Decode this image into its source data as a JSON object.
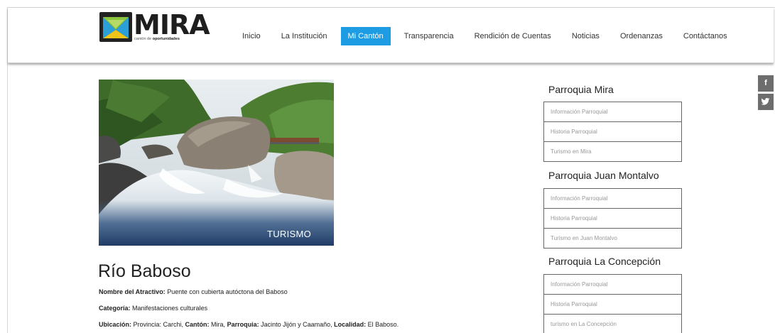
{
  "logo": {
    "name": "MIRA",
    "tagline_prefix": "cantón de",
    "tagline_strong": "oportunidades"
  },
  "nav": {
    "items": [
      {
        "label": "Inicio"
      },
      {
        "label": "La Institución"
      },
      {
        "label": "Mi Cantón",
        "active": true
      },
      {
        "label": "Transparencia"
      },
      {
        "label": "Rendición de Cuentas"
      },
      {
        "label": "Noticias"
      },
      {
        "label": "Ordenanzas"
      },
      {
        "label": "Contáctanos"
      }
    ],
    "active_color": "#1e9ce3"
  },
  "hero": {
    "label": "TURISMO"
  },
  "article": {
    "title": "Río Baboso",
    "nombre_label": "Nombre del Atractivo:",
    "nombre_value": " Puente con cubierta autóctona del Baboso",
    "categoria_label": "Categoría:",
    "categoria_value": " Manifestaciones culturales",
    "ubicacion_label": "Ubicación:",
    "ubicacion_provincia_value": " Provincia: Carchi, ",
    "canton_label": "Cantón:",
    "canton_value": " Mira, ",
    "parroquia_label": "Parroquia:",
    "parroquia_value": " Jacinto Jijón y Caamaño, ",
    "localidad_label": "Localidad:",
    "localidad_value": " El Baboso."
  },
  "sidebar": {
    "sections": [
      {
        "title": "Parroquia Mira",
        "items": [
          "Información Parroquial",
          "Historia Parroquial",
          "Turismo en Mira"
        ]
      },
      {
        "title": "Parroquia Juan Montalvo",
        "items": [
          "Información Parroquial",
          "Historia Parroquial",
          "Turismo en Juan Montalvo"
        ]
      },
      {
        "title": "Parroquia La Concepción",
        "items": [
          "Información Parroquial",
          "Historia Parroquial",
          "turismo en La Concepción"
        ]
      }
    ]
  },
  "social": {
    "facebook_glyph": "f",
    "twitter_glyph": "🐦"
  }
}
